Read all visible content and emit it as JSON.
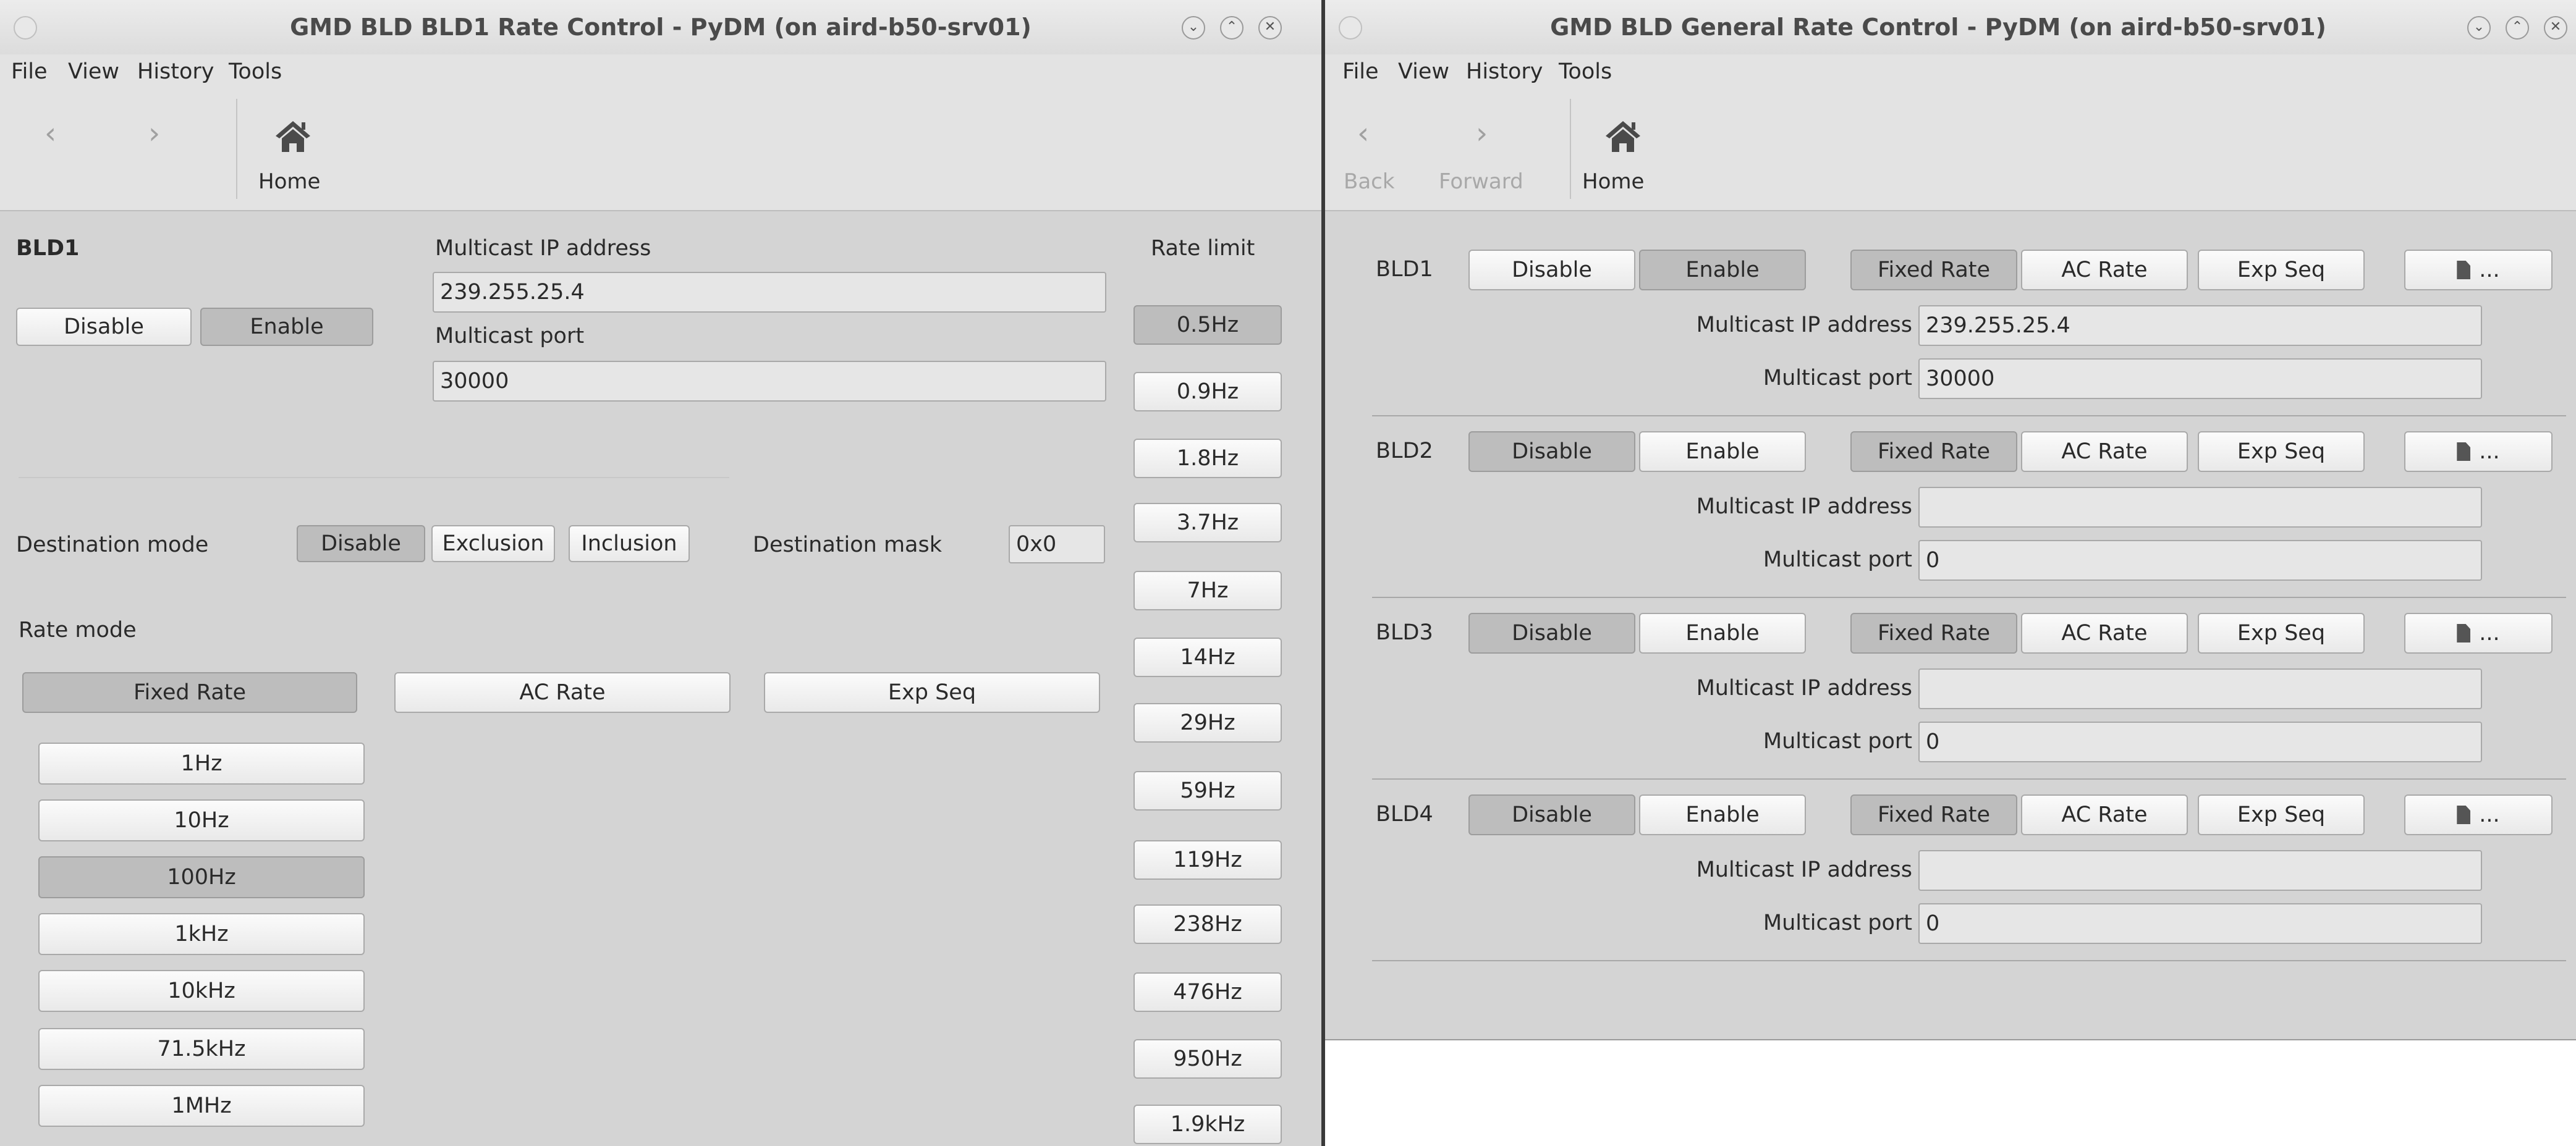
{
  "left_window": {
    "title": "GMD BLD BLD1 Rate Control - PyDM (on aird-b50-srv01)",
    "menu": [
      "File",
      "View",
      "History",
      "Tools"
    ],
    "toolbar": {
      "home_label": "Home"
    },
    "section_title": "BLD1",
    "disable_label": "Disable",
    "enable_label": "Enable",
    "ip_label": "Multicast IP address",
    "ip_value": "239.255.25.4",
    "port_label": "Multicast port",
    "port_value": "30000",
    "dest_mode_label": "Destination mode",
    "dest_disable": "Disable",
    "dest_exclusion": "Exclusion",
    "dest_inclusion": "Inclusion",
    "dest_mask_label": "Destination mask",
    "dest_mask_value": "0x0",
    "rate_mode_label": "Rate mode",
    "fixed_rate": "Fixed Rate",
    "ac_rate": "AC Rate",
    "exp_seq": "Exp Seq",
    "fixed_rates": [
      "1Hz",
      "10Hz",
      "100Hz",
      "1kHz",
      "10kHz",
      "71.5kHz",
      "1MHz"
    ],
    "rate_limit_label": "Rate limit",
    "rate_limits": [
      "0.5Hz",
      "0.9Hz",
      "1.8Hz",
      "3.7Hz",
      "7Hz",
      "14Hz",
      "29Hz",
      "59Hz",
      "119Hz",
      "238Hz",
      "476Hz",
      "950Hz",
      "1.9kHz"
    ]
  },
  "right_window": {
    "title": "GMD BLD General Rate Control - PyDM (on aird-b50-srv01)",
    "menu": [
      "File",
      "View",
      "History",
      "Tools"
    ],
    "toolbar": {
      "back_label": "Back",
      "forward_label": "Forward",
      "home_label": "Home"
    },
    "buttons": {
      "disable": "Disable",
      "enable": "Enable",
      "fixed_rate": "Fixed Rate",
      "ac_rate": "AC Rate",
      "exp_seq": "Exp Seq",
      "file": "..."
    },
    "ip_label": "Multicast IP address",
    "port_label": "Multicast port",
    "rows": [
      {
        "name": "BLD1",
        "ip": "239.255.25.4",
        "port": "30000"
      },
      {
        "name": "BLD2",
        "ip": "",
        "port": "0"
      },
      {
        "name": "BLD3",
        "ip": "",
        "port": "0"
      },
      {
        "name": "BLD4",
        "ip": "",
        "port": "0"
      }
    ]
  }
}
